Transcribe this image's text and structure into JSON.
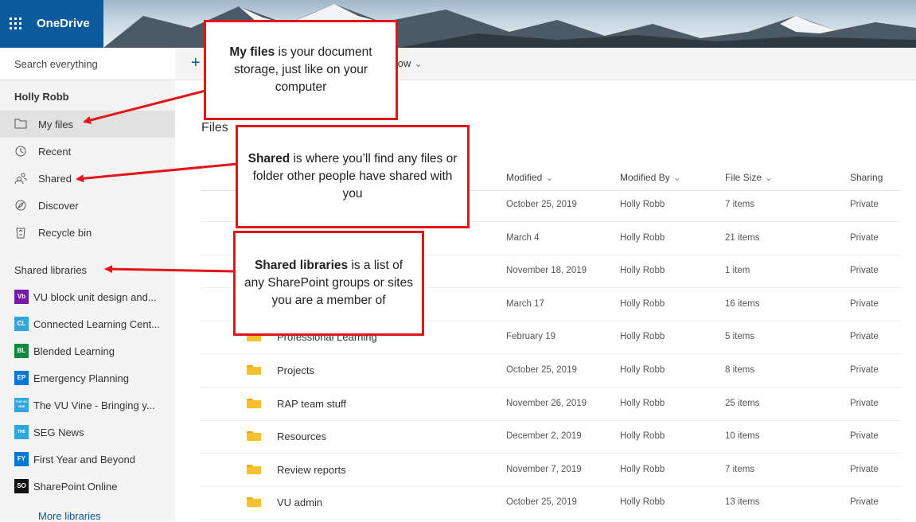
{
  "app": {
    "name": "OneDrive"
  },
  "search": {
    "placeholder": "Search everything"
  },
  "user": {
    "name": "Holly Robb"
  },
  "nav": [
    {
      "label": "My files",
      "icon": "folder-icon",
      "selected": true
    },
    {
      "label": "Recent",
      "icon": "clock-icon"
    },
    {
      "label": "Shared",
      "icon": "people-icon"
    },
    {
      "label": "Discover",
      "icon": "compass-icon"
    },
    {
      "label": "Recycle bin",
      "icon": "recycle-bin-icon"
    }
  ],
  "shared_libraries": {
    "title": "Shared libraries",
    "items": [
      {
        "tile": "Vb",
        "color": "#7719aa",
        "label": "VU block unit design and..."
      },
      {
        "tile": "CL",
        "color": "#2ea6de",
        "label": "Connected Learning Cent..."
      },
      {
        "tile": "BL",
        "color": "#10893e",
        "label": "Blended Learning"
      },
      {
        "tile": "EP",
        "color": "#0078d4",
        "label": "Emergency Planning"
      },
      {
        "tile": "THE VU VINE",
        "color": "#2ea6de",
        "label": "The VU Vine - Bringing y..."
      },
      {
        "tile": "THE",
        "color": "#2ea6de",
        "label": "SEG News"
      },
      {
        "tile": "FY",
        "color": "#0078d4",
        "label": "First Year and Beyond"
      },
      {
        "tile": "SO",
        "color": "#111111",
        "label": "SharePoint Online"
      }
    ],
    "more": "More libraries"
  },
  "commandbar": {
    "new": "+",
    "flow": "Flow"
  },
  "main": {
    "title": "Files",
    "columns": {
      "modified": "Modified",
      "modified_by": "Modified By",
      "file_size": "File Size",
      "sharing": "Sharing"
    },
    "rows": [
      {
        "name": "",
        "modified": "October 25, 2019",
        "by": "Holly Robb",
        "size": "7 items",
        "sharing": "Private"
      },
      {
        "name": "",
        "modified": "March 4",
        "by": "Holly Robb",
        "size": "21 items",
        "sharing": "Private"
      },
      {
        "name": "",
        "modified": "November 18, 2019",
        "by": "Holly Robb",
        "size": "1 item",
        "sharing": "Private"
      },
      {
        "name": "",
        "modified": "March 17",
        "by": "Holly Robb",
        "size": "16 items",
        "sharing": "Private"
      },
      {
        "name": "Professional Learning",
        "modified": "February 19",
        "by": "Holly Robb",
        "size": "5 items",
        "sharing": "Private"
      },
      {
        "name": "Projects",
        "modified": "October 25, 2019",
        "by": "Holly Robb",
        "size": "8 items",
        "sharing": "Private"
      },
      {
        "name": "RAP team stuff",
        "modified": "November 26, 2019",
        "by": "Holly Robb",
        "size": "25 items",
        "sharing": "Private"
      },
      {
        "name": "Resources",
        "modified": "December 2, 2019",
        "by": "Holly Robb",
        "size": "10 items",
        "sharing": "Private"
      },
      {
        "name": "Review reports",
        "modified": "November 7, 2019",
        "by": "Holly Robb",
        "size": "7 items",
        "sharing": "Private"
      },
      {
        "name": "VU admin",
        "modified": "October 25, 2019",
        "by": "Holly Robb",
        "size": "13 items",
        "sharing": "Private"
      }
    ]
  },
  "callouts": {
    "my_files": {
      "bold": "My files",
      "text": " is your document storage, just like on your computer"
    },
    "shared": {
      "bold": "Shared",
      "text": " is where you’ll find any files or folder other people have shared with you"
    },
    "libraries": {
      "bold": "Shared libraries",
      "text": " is a list of any SharePoint groups or sites you are a member of"
    }
  },
  "colors": {
    "suite_bar": "#0a5a9c",
    "callout_border": "#e4141b",
    "folder": "#f5c12f"
  }
}
